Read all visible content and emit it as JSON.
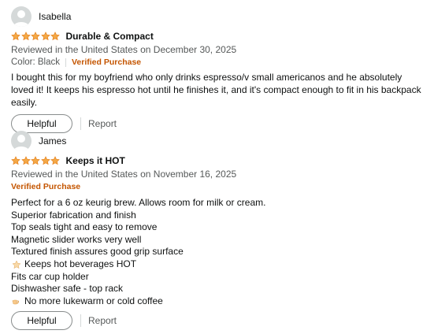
{
  "reviews": [
    {
      "author": "Isabella",
      "rating": 5,
      "title": "Durable & Compact",
      "reviewed": "Reviewed in the United States on December 30, 2025",
      "format": "Color: Black",
      "verified": "Verified Purchase",
      "body": "I bought this for my boyfriend who only drinks espresso/v small americanos and he absolutely loved it! It keeps his espresso hot until he finishes it, and it's compact enough to fit in his backpack easily.",
      "helpful_label": "Helpful",
      "report_label": "Report"
    },
    {
      "author": "James",
      "rating": 5,
      "title": "Keeps it HOT",
      "reviewed": "Reviewed in the United States on November 16, 2025",
      "verified": "Verified Purchase",
      "lines": [
        {
          "text": "Perfect for a 6 oz keurig brew. Allows room for milk or cream."
        },
        {
          "text": "Superior fabrication and finish"
        },
        {
          "text": "Top seals tight and easy to remove"
        },
        {
          "text": "Magnetic slider works very well"
        },
        {
          "text": "Textured finish assures good grip surface"
        },
        {
          "text": "Keeps hot beverages HOT",
          "icon": "star-emoji-icon"
        },
        {
          "text": "Fits car cup holder"
        },
        {
          "text": "Dishwasher safe - top rack"
        },
        {
          "text": "No more lukewarm or cold coffee",
          "icon": "pointing-hand-emoji-icon"
        }
      ],
      "helpful_label": "Helpful",
      "report_label": "Report"
    }
  ],
  "colors": {
    "star": "#f3a847",
    "star_outline": "#e47911",
    "verified": "#c45500",
    "meta": "#565959",
    "text": "#0f1111"
  },
  "icons": {
    "avatar": "default-user-avatar-icon",
    "rating_star": "star-filled-icon"
  }
}
